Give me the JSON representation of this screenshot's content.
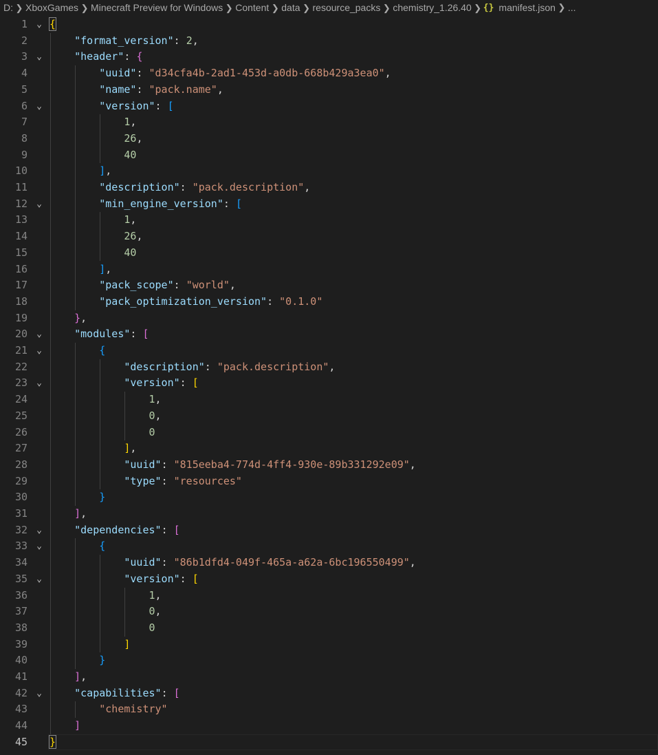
{
  "breadcrumb": {
    "items": [
      "D:",
      "XboxGames",
      "Minecraft Preview for Windows",
      "Content",
      "data",
      "resource_packs",
      "chemistry_1.26.40"
    ],
    "file_icon": "{}",
    "file_name": "manifest.json",
    "overflow": "..."
  },
  "editor": {
    "lines": [
      {
        "n": "1",
        "fold": true,
        "tokens": [
          {
            "t": "{",
            "c": "b1 bracket-box"
          }
        ]
      },
      {
        "n": "2",
        "tokens": [
          {
            "t": "    "
          },
          {
            "t": "\"format_version\"",
            "c": "k"
          },
          {
            "t": ": ",
            "c": "p"
          },
          {
            "t": "2",
            "c": "n"
          },
          {
            "t": ",",
            "c": "p"
          }
        ]
      },
      {
        "n": "3",
        "fold": true,
        "tokens": [
          {
            "t": "    "
          },
          {
            "t": "\"header\"",
            "c": "k"
          },
          {
            "t": ": ",
            "c": "p"
          },
          {
            "t": "{",
            "c": "b2"
          }
        ]
      },
      {
        "n": "4",
        "tokens": [
          {
            "t": "        "
          },
          {
            "t": "\"uuid\"",
            "c": "k"
          },
          {
            "t": ": ",
            "c": "p"
          },
          {
            "t": "\"d34cfa4b-2ad1-453d-a0db-668b429a3ea0\"",
            "c": "s"
          },
          {
            "t": ",",
            "c": "p"
          }
        ]
      },
      {
        "n": "5",
        "tokens": [
          {
            "t": "        "
          },
          {
            "t": "\"name\"",
            "c": "k"
          },
          {
            "t": ": ",
            "c": "p"
          },
          {
            "t": "\"pack.name\"",
            "c": "s"
          },
          {
            "t": ",",
            "c": "p"
          }
        ]
      },
      {
        "n": "6",
        "fold": true,
        "tokens": [
          {
            "t": "        "
          },
          {
            "t": "\"version\"",
            "c": "k"
          },
          {
            "t": ": ",
            "c": "p"
          },
          {
            "t": "[",
            "c": "b3"
          }
        ]
      },
      {
        "n": "7",
        "tokens": [
          {
            "t": "            "
          },
          {
            "t": "1",
            "c": "n"
          },
          {
            "t": ",",
            "c": "p"
          }
        ]
      },
      {
        "n": "8",
        "tokens": [
          {
            "t": "            "
          },
          {
            "t": "26",
            "c": "n"
          },
          {
            "t": ",",
            "c": "p"
          }
        ]
      },
      {
        "n": "9",
        "tokens": [
          {
            "t": "            "
          },
          {
            "t": "40",
            "c": "n"
          }
        ]
      },
      {
        "n": "10",
        "tokens": [
          {
            "t": "        "
          },
          {
            "t": "]",
            "c": "b3"
          },
          {
            "t": ",",
            "c": "p"
          }
        ]
      },
      {
        "n": "11",
        "tokens": [
          {
            "t": "        "
          },
          {
            "t": "\"description\"",
            "c": "k"
          },
          {
            "t": ": ",
            "c": "p"
          },
          {
            "t": "\"pack.description\"",
            "c": "s"
          },
          {
            "t": ",",
            "c": "p"
          }
        ]
      },
      {
        "n": "12",
        "fold": true,
        "tokens": [
          {
            "t": "        "
          },
          {
            "t": "\"min_engine_version\"",
            "c": "k"
          },
          {
            "t": ": ",
            "c": "p"
          },
          {
            "t": "[",
            "c": "b3"
          }
        ]
      },
      {
        "n": "13",
        "tokens": [
          {
            "t": "            "
          },
          {
            "t": "1",
            "c": "n"
          },
          {
            "t": ",",
            "c": "p"
          }
        ]
      },
      {
        "n": "14",
        "tokens": [
          {
            "t": "            "
          },
          {
            "t": "26",
            "c": "n"
          },
          {
            "t": ",",
            "c": "p"
          }
        ]
      },
      {
        "n": "15",
        "tokens": [
          {
            "t": "            "
          },
          {
            "t": "40",
            "c": "n"
          }
        ]
      },
      {
        "n": "16",
        "tokens": [
          {
            "t": "        "
          },
          {
            "t": "]",
            "c": "b3"
          },
          {
            "t": ",",
            "c": "p"
          }
        ]
      },
      {
        "n": "17",
        "tokens": [
          {
            "t": "        "
          },
          {
            "t": "\"pack_scope\"",
            "c": "k"
          },
          {
            "t": ": ",
            "c": "p"
          },
          {
            "t": "\"world\"",
            "c": "s"
          },
          {
            "t": ",",
            "c": "p"
          }
        ]
      },
      {
        "n": "18",
        "tokens": [
          {
            "t": "        "
          },
          {
            "t": "\"pack_optimization_version\"",
            "c": "k"
          },
          {
            "t": ": ",
            "c": "p"
          },
          {
            "t": "\"0.1.0\"",
            "c": "s"
          }
        ]
      },
      {
        "n": "19",
        "tokens": [
          {
            "t": "    "
          },
          {
            "t": "}",
            "c": "b2"
          },
          {
            "t": ",",
            "c": "p"
          }
        ]
      },
      {
        "n": "20",
        "fold": true,
        "tokens": [
          {
            "t": "    "
          },
          {
            "t": "\"modules\"",
            "c": "k"
          },
          {
            "t": ": ",
            "c": "p"
          },
          {
            "t": "[",
            "c": "b2"
          }
        ]
      },
      {
        "n": "21",
        "fold": true,
        "tokens": [
          {
            "t": "        "
          },
          {
            "t": "{",
            "c": "b3"
          }
        ]
      },
      {
        "n": "22",
        "tokens": [
          {
            "t": "            "
          },
          {
            "t": "\"description\"",
            "c": "k"
          },
          {
            "t": ": ",
            "c": "p"
          },
          {
            "t": "\"pack.description\"",
            "c": "s"
          },
          {
            "t": ",",
            "c": "p"
          }
        ]
      },
      {
        "n": "23",
        "fold": true,
        "tokens": [
          {
            "t": "            "
          },
          {
            "t": "\"version\"",
            "c": "k"
          },
          {
            "t": ": ",
            "c": "p"
          },
          {
            "t": "[",
            "c": "b1"
          }
        ]
      },
      {
        "n": "24",
        "tokens": [
          {
            "t": "                "
          },
          {
            "t": "1",
            "c": "n"
          },
          {
            "t": ",",
            "c": "p"
          }
        ]
      },
      {
        "n": "25",
        "tokens": [
          {
            "t": "                "
          },
          {
            "t": "0",
            "c": "n"
          },
          {
            "t": ",",
            "c": "p"
          }
        ]
      },
      {
        "n": "26",
        "tokens": [
          {
            "t": "                "
          },
          {
            "t": "0",
            "c": "n"
          }
        ]
      },
      {
        "n": "27",
        "tokens": [
          {
            "t": "            "
          },
          {
            "t": "]",
            "c": "b1"
          },
          {
            "t": ",",
            "c": "p"
          }
        ]
      },
      {
        "n": "28",
        "tokens": [
          {
            "t": "            "
          },
          {
            "t": "\"uuid\"",
            "c": "k"
          },
          {
            "t": ": ",
            "c": "p"
          },
          {
            "t": "\"815eeba4-774d-4ff4-930e-89b331292e09\"",
            "c": "s"
          },
          {
            "t": ",",
            "c": "p"
          }
        ]
      },
      {
        "n": "29",
        "tokens": [
          {
            "t": "            "
          },
          {
            "t": "\"type\"",
            "c": "k"
          },
          {
            "t": ": ",
            "c": "p"
          },
          {
            "t": "\"resources\"",
            "c": "s"
          }
        ]
      },
      {
        "n": "30",
        "tokens": [
          {
            "t": "        "
          },
          {
            "t": "}",
            "c": "b3"
          }
        ]
      },
      {
        "n": "31",
        "tokens": [
          {
            "t": "    "
          },
          {
            "t": "]",
            "c": "b2"
          },
          {
            "t": ",",
            "c": "p"
          }
        ]
      },
      {
        "n": "32",
        "fold": true,
        "tokens": [
          {
            "t": "    "
          },
          {
            "t": "\"dependencies\"",
            "c": "k"
          },
          {
            "t": ": ",
            "c": "p"
          },
          {
            "t": "[",
            "c": "b2"
          }
        ]
      },
      {
        "n": "33",
        "fold": true,
        "tokens": [
          {
            "t": "        "
          },
          {
            "t": "{",
            "c": "b3"
          }
        ]
      },
      {
        "n": "34",
        "tokens": [
          {
            "t": "            "
          },
          {
            "t": "\"uuid\"",
            "c": "k"
          },
          {
            "t": ": ",
            "c": "p"
          },
          {
            "t": "\"86b1dfd4-049f-465a-a62a-6bc196550499\"",
            "c": "s"
          },
          {
            "t": ",",
            "c": "p"
          }
        ]
      },
      {
        "n": "35",
        "fold": true,
        "tokens": [
          {
            "t": "            "
          },
          {
            "t": "\"version\"",
            "c": "k"
          },
          {
            "t": ": ",
            "c": "p"
          },
          {
            "t": "[",
            "c": "b1"
          }
        ]
      },
      {
        "n": "36",
        "tokens": [
          {
            "t": "                "
          },
          {
            "t": "1",
            "c": "n"
          },
          {
            "t": ",",
            "c": "p"
          }
        ]
      },
      {
        "n": "37",
        "tokens": [
          {
            "t": "                "
          },
          {
            "t": "0",
            "c": "n"
          },
          {
            "t": ",",
            "c": "p"
          }
        ]
      },
      {
        "n": "38",
        "tokens": [
          {
            "t": "                "
          },
          {
            "t": "0",
            "c": "n"
          }
        ]
      },
      {
        "n": "39",
        "tokens": [
          {
            "t": "            "
          },
          {
            "t": "]",
            "c": "b1"
          }
        ]
      },
      {
        "n": "40",
        "tokens": [
          {
            "t": "        "
          },
          {
            "t": "}",
            "c": "b3"
          }
        ]
      },
      {
        "n": "41",
        "tokens": [
          {
            "t": "    "
          },
          {
            "t": "]",
            "c": "b2"
          },
          {
            "t": ",",
            "c": "p"
          }
        ]
      },
      {
        "n": "42",
        "fold": true,
        "tokens": [
          {
            "t": "    "
          },
          {
            "t": "\"capabilities\"",
            "c": "k"
          },
          {
            "t": ": ",
            "c": "p"
          },
          {
            "t": "[",
            "c": "b2"
          }
        ]
      },
      {
        "n": "43",
        "tokens": [
          {
            "t": "        "
          },
          {
            "t": "\"chemistry\"",
            "c": "s"
          }
        ]
      },
      {
        "n": "44",
        "tokens": [
          {
            "t": "    "
          },
          {
            "t": "]",
            "c": "b2"
          }
        ]
      },
      {
        "n": "45",
        "current": true,
        "tokens": [
          {
            "t": "}",
            "c": "b1 bracket-box"
          }
        ]
      }
    ]
  },
  "colors": {
    "background": "#1e1e1e",
    "key": "#9cdcfe",
    "string": "#ce9178",
    "number": "#b5cea8",
    "bracket_level1": "#ffd700",
    "bracket_level2": "#da70d6",
    "bracket_level3": "#179fff"
  }
}
